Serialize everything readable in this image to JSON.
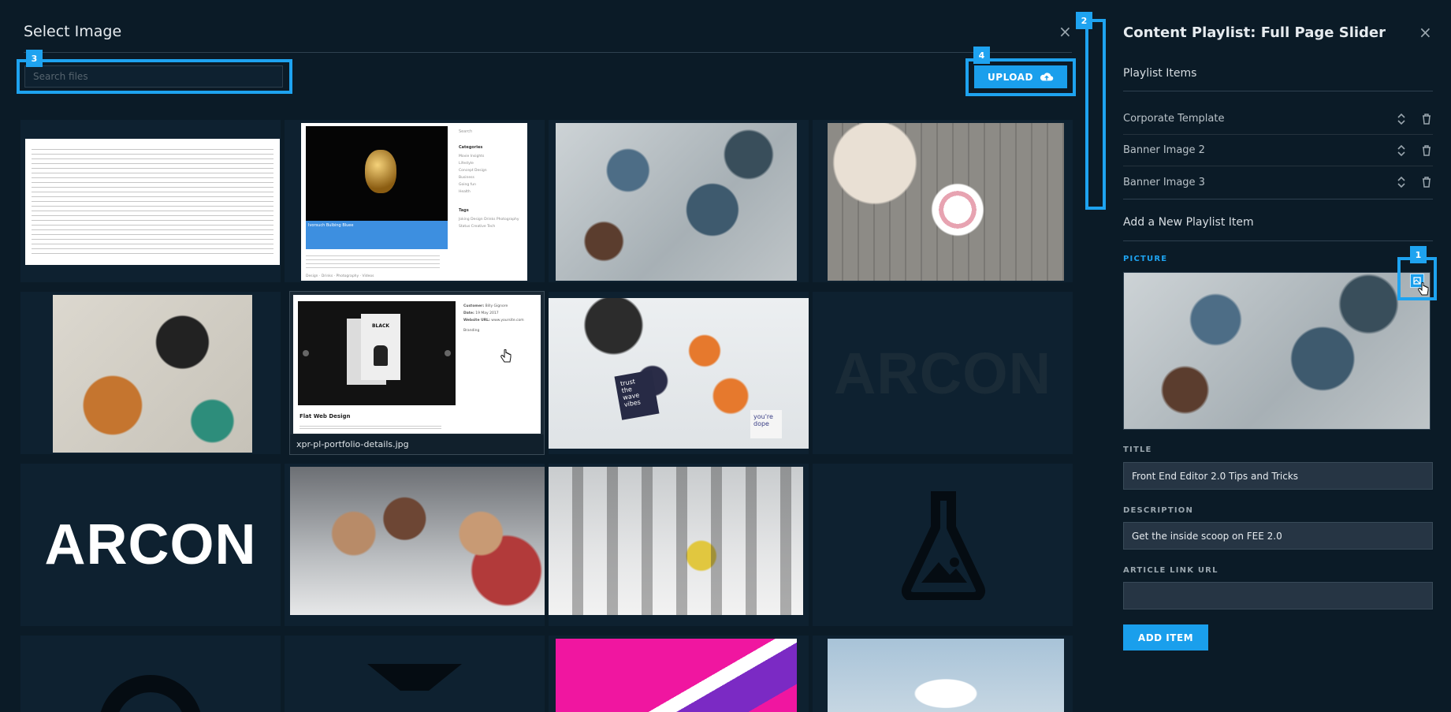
{
  "modal": {
    "title": "Select Image",
    "close": "×",
    "search_placeholder": "Search files",
    "upload_label": "UPLOAD"
  },
  "badges": [
    "1",
    "2",
    "3",
    "4"
  ],
  "grid": {
    "hover_caption": "xpr-pl-portfolio-details.jpg",
    "logo_text": "ARCON",
    "cells": [
      {
        "kind": "document"
      },
      {
        "kind": "blog-screenshot"
      },
      {
        "kind": "office-desk-photo"
      },
      {
        "kind": "table-coffee-photo"
      },
      {
        "kind": "travel-flatlay-photo"
      },
      {
        "kind": "portfolio-screenshot"
      },
      {
        "kind": "desk-shoes-photo"
      },
      {
        "kind": "logo-dark"
      },
      {
        "kind": "logo-white"
      },
      {
        "kind": "team-photo"
      },
      {
        "kind": "group-photo"
      },
      {
        "kind": "placeholder-flask-icon"
      },
      {
        "kind": "placeholder-icon"
      },
      {
        "kind": "placeholder-icon"
      },
      {
        "kind": "magenta-package-photo"
      },
      {
        "kind": "blue-book-photo"
      }
    ],
    "screenshot_blog": {
      "search": "Search",
      "categories_title": "Categories",
      "categories": [
        "Movie Insights",
        "Lifestyle",
        "Concept Design",
        "Business",
        "Going fun",
        "Health"
      ],
      "tags_title": "Tags",
      "tags": [
        "Joking",
        "Design",
        "Drinks",
        "Photography",
        "Status",
        "Creative",
        "Tech"
      ],
      "caption": "Ivorsuch Bulbing Bluee",
      "footer_tags": [
        "Design",
        "Drinks",
        "Photography",
        "Videos"
      ]
    },
    "screenshot_portfolio": {
      "book_text": "BLACK",
      "customer_label": "Customer:",
      "customer": "Billy Gignore",
      "date_label": "Date:",
      "date": "19 May 2017",
      "website_label": "Website URL:",
      "website": "www.yoursite.com",
      "branding": "Branding",
      "title": "Flat Web Design"
    },
    "shoes_card": [
      "trust",
      "the",
      "wave",
      "vibes"
    ],
    "shoes_card2": [
      "you're",
      "dope"
    ]
  },
  "panel": {
    "title": "Content Playlist: Full Page Slider",
    "close": "×",
    "playlist_title": "Playlist Items",
    "items": [
      "Corporate Template",
      "Banner Image 2",
      "Banner Image 3"
    ],
    "add_title": "Add a New Playlist Item",
    "picture_label": "PICTURE",
    "title_label": "TITLE",
    "title_value": "Front End Editor 2.0 Tips and Tricks",
    "description_label": "DESCRIPTION",
    "description_value": "Get the inside scoop on FEE 2.0",
    "link_label": "ARTICLE LINK URL",
    "link_value": "",
    "add_button": "ADD ITEM"
  },
  "colors": {
    "accent": "#1ea3f0",
    "background": "#0b1b27",
    "input_bg": "#263544"
  },
  "icons": {
    "close": "close-icon",
    "upload": "cloud-upload-icon",
    "sort": "sort-icon",
    "delete": "trash-icon",
    "image": "image-icon",
    "placeholder": "flask-image-icon"
  }
}
